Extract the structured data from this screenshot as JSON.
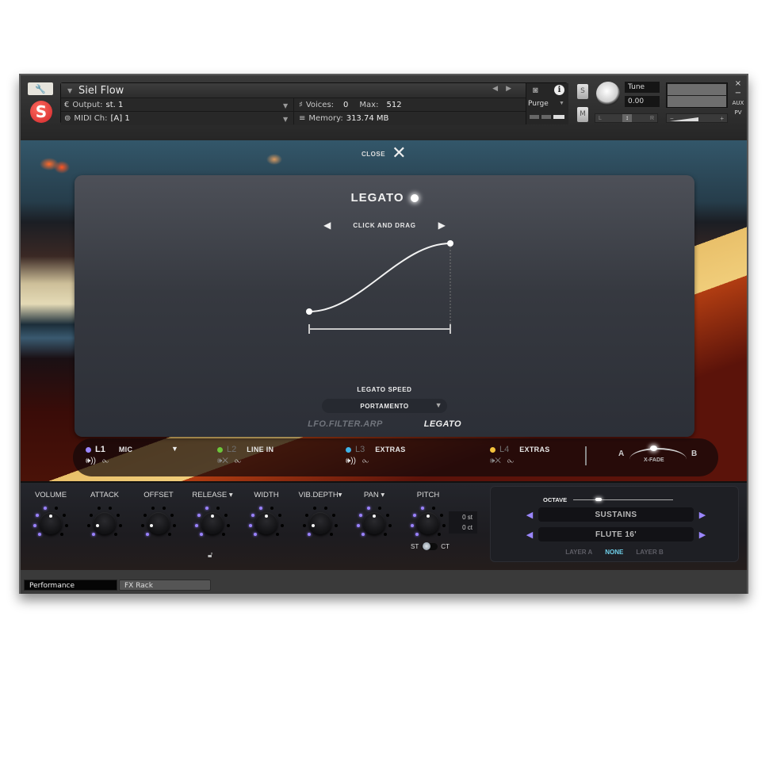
{
  "header": {
    "instrument_name": "Siel Flow",
    "output_label": "Output:",
    "output_value": "st. 1",
    "midi_label": "MIDI Ch:",
    "midi_value": "[A]  1",
    "voices_label": "Voices:",
    "voices_value": "0",
    "max_label": "Max:",
    "max_value": "512",
    "memory_label": "Memory:",
    "memory_value": "313.74 MB",
    "purge_label": "Purge",
    "solo_label": "S",
    "mute_label": "M",
    "tune_label": "Tune",
    "tune_value": "0.00",
    "pan_left": "L",
    "pan_right": "R",
    "vol_minus": "−",
    "vol_plus": "+",
    "win_close": "×",
    "win_min": "−",
    "aux_label": "AUX",
    "pv_label": "PV"
  },
  "overlay": {
    "close_label": "CLOSE",
    "title": "LEGATO",
    "nav_label": "CLICK AND DRAG",
    "curve": {
      "start": [
        0,
        0
      ],
      "end": [
        1,
        1
      ],
      "shape": "s-curve"
    },
    "speed_label": "LEGATO SPEED",
    "speed_value": "PORTAMENTO",
    "tabs": [
      {
        "label": "LFO.FILTER.ARP",
        "active": false
      },
      {
        "label": "LEGATO",
        "active": true
      }
    ]
  },
  "layers": [
    {
      "id": "L1",
      "source": "MIC",
      "color": "#9a86ff",
      "active": true,
      "muted": false,
      "has_dropdown": true
    },
    {
      "id": "L2",
      "source": "LINE IN",
      "color": "#6cc63a",
      "active": false,
      "muted": true
    },
    {
      "id": "L3",
      "source": "EXTRAS",
      "color": "#3fb3e8",
      "active": false,
      "muted": false
    },
    {
      "id": "L4",
      "source": "EXTRAS",
      "color": "#f3c23c",
      "active": false,
      "muted": true
    }
  ],
  "xfade": {
    "a": "A",
    "b": "B",
    "label": "X-FADE",
    "value": 0.5
  },
  "knobs": [
    {
      "label": "VOLUME",
      "value": 0.5
    },
    {
      "label": "ATTACK",
      "value": 0.1
    },
    {
      "label": "OFFSET",
      "value": 0.1
    },
    {
      "label": "RELEASE ▾",
      "value": 0.5
    },
    {
      "label": "WIDTH",
      "value": 0.5
    },
    {
      "label": "VIB.DEPTH▾",
      "value": 0.1
    },
    {
      "label": "PAN  ▾",
      "value": 0.5
    },
    {
      "label": "PITCH",
      "value": 0.5
    }
  ],
  "pitch": {
    "st": "0 st",
    "ct": "0 ct",
    "toggle_left": "ST",
    "toggle_right": "CT"
  },
  "octave": {
    "label": "OCTAVE",
    "value": 0.25
  },
  "selectors": {
    "category": "SUSTAINS",
    "preset": "FLUTE 16'"
  },
  "layer_select": [
    {
      "label": "LAYER A",
      "active": false
    },
    {
      "label": "NONE",
      "active": true
    },
    {
      "label": "LAYER B",
      "active": false
    }
  ],
  "bottom_tabs": [
    {
      "label": "Performance",
      "active": true
    },
    {
      "label": "FX Rack",
      "active": false
    }
  ]
}
